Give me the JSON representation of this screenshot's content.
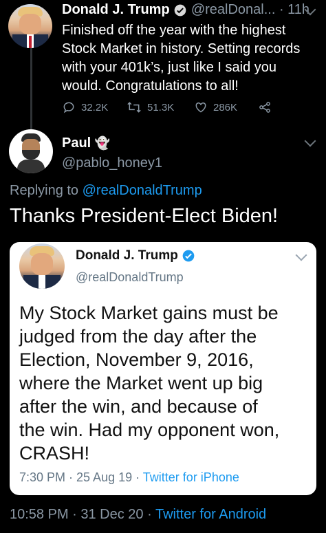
{
  "top_tweet": {
    "display_name": "Donald J. Trump",
    "handle": "@realDonal...",
    "time": "· 11h",
    "text_lines": [
      "Finished off the year with the highest",
      "Stock Market in history. Setting records",
      "with your 401k’s, just like I said you",
      "would. Congratulations to all!"
    ],
    "replies": "32.2K",
    "retweets": "51.3K",
    "likes": "286K"
  },
  "reply": {
    "display_name": "Paul",
    "handle": "@pablo_honey1",
    "replying_prefix": "Replying to",
    "replying_to": "@realDonaldTrump",
    "text": "Thanks President-Elect Biden!"
  },
  "quoted_card": {
    "display_name": "Donald J. Trump",
    "handle": "@realDonaldTrump",
    "text_lines": [
      "My Stock Market gains must be",
      "judged from the day after the",
      "Election, November 9, 2016,",
      "where the Market went up big",
      "after the win, and because of",
      "the win. Had my opponent won,",
      "CRASH!"
    ],
    "time": "7:30 PM · 25 Aug 19 ·",
    "source": "Twitter for iPhone"
  },
  "footer": {
    "time": "10:58 PM · 31 Dec 20 ·",
    "source": "Twitter for Android"
  },
  "colors": {
    "link": "#1d9bf0",
    "verified": "#1d9bf0",
    "muted": "#8b98a5"
  }
}
